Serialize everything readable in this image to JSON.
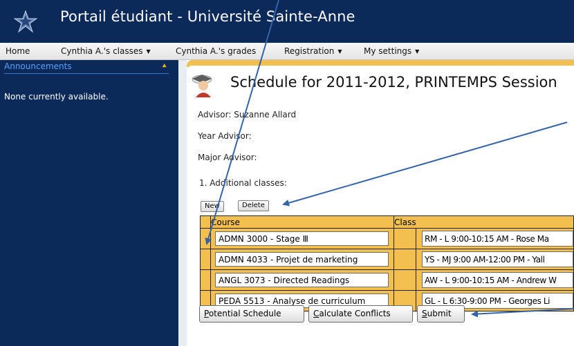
{
  "app": {
    "title": "Portail étudiant - Université Sainte-Anne"
  },
  "menu": {
    "home": "Home",
    "classes": "Cynthia A.'s classes",
    "grades": "Cynthia A.'s grades",
    "registration": "Registration",
    "settings": "My settings"
  },
  "sidebar": {
    "announcements_label": "Announcements",
    "empty_text": "None currently available."
  },
  "page": {
    "title": "Schedule for 2011-2012, PRINTEMPS Session",
    "advisor": "Advisor: Suzanne Allard",
    "year_advisor": "Year Advisor:",
    "major_advisor": "Major Advisor:",
    "section_label": "1. Additional classes:"
  },
  "toolbar": {
    "new_label": "New",
    "delete_label": "Delete"
  },
  "table": {
    "headers": {
      "course": "Course",
      "class": "Class"
    },
    "rows": [
      {
        "course": "ADMN 3000 - Stage Ⅲ",
        "class": "RM - L 9:00-10:15 AM - Rose Ma"
      },
      {
        "course": "ADMN 4033 - Projet de marketing",
        "class": "YS - MJ 9:00 AM-12:00 PM - Yall"
      },
      {
        "course": "ANGL 3073 - Directed Readings",
        "class": "AW - L 9:00-10:15 AM - Andrew W"
      },
      {
        "course": "PEDA 5513 - Analyse de curriculum",
        "class": "GL - L 6:30-9:00 PM - Georges Li"
      }
    ]
  },
  "actions": {
    "potential_first": "P",
    "potential_rest": "otential Schedule",
    "conflicts_first": "C",
    "conflicts_rest": "alculate Conflicts",
    "submit_first": "S",
    "submit_rest": "ubmit"
  },
  "colors": {
    "banner": "#0b2a59",
    "sidebar": "#0b2a59",
    "accent": "#f3bf4f",
    "sidebar_heading": "#5aa0ff",
    "arrow": "#3563a8"
  },
  "icons": {
    "logo": "star-logo-icon",
    "collapse": "double-chevron-up-icon",
    "page": "graduate-icon",
    "caret": "triangle-down-icon"
  }
}
